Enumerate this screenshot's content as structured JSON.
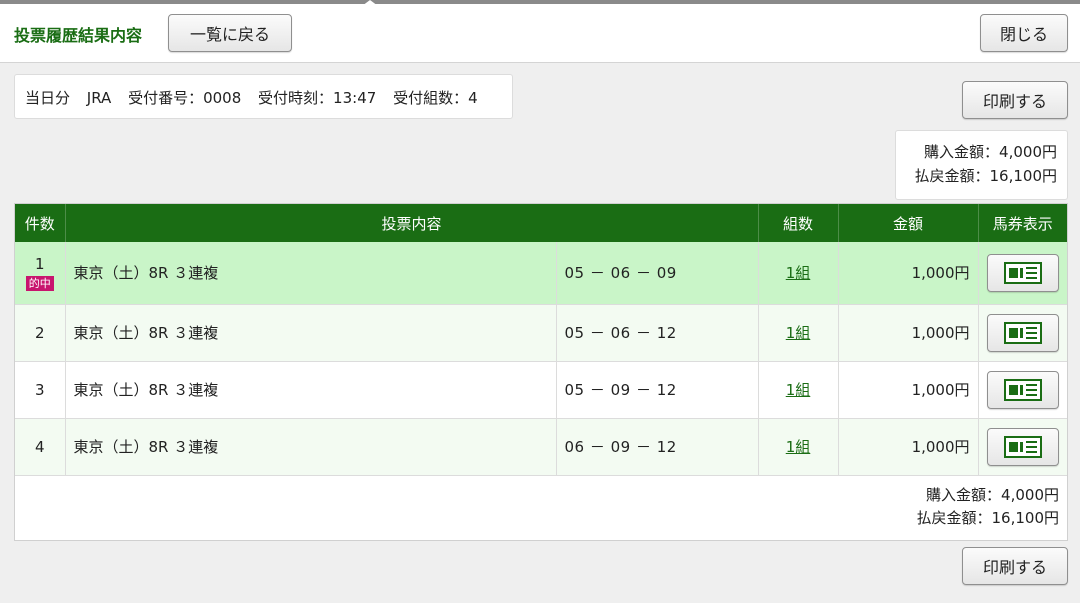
{
  "header": {
    "title": "投票履歴結果内容",
    "back_label": "一覧に戻る",
    "close_label": "閉じる"
  },
  "info": {
    "day": "当日分",
    "org": "JRA",
    "receipt_no": "受付番号：0008",
    "receipt_time": "受付時刻：13:47",
    "combo_count": "受付組数：4"
  },
  "print_label": "印刷する",
  "summary": {
    "purchase": "購入金額：4,000円",
    "refund": "払戻金額：16,100円"
  },
  "table": {
    "headers": {
      "num": "件数",
      "content": "投票内容",
      "kumi": "組数",
      "amount": "金額",
      "ticket": "馬券表示"
    },
    "rows": [
      {
        "num": "1",
        "badge": "的中",
        "race": "東京（土）8R ３連複",
        "combo": "05 － 06 － 09",
        "kumi": "1組",
        "amount": "1,000円"
      },
      {
        "num": "2",
        "badge": "",
        "race": "東京（土）8R ３連複",
        "combo": "05 － 06 － 12",
        "kumi": "1組",
        "amount": "1,000円"
      },
      {
        "num": "3",
        "badge": "",
        "race": "東京（土）8R ３連複",
        "combo": "05 － 09 － 12",
        "kumi": "1組",
        "amount": "1,000円"
      },
      {
        "num": "4",
        "badge": "",
        "race": "東京（土）8R ３連複",
        "combo": "06 － 09 － 12",
        "kumi": "1組",
        "amount": "1,000円"
      }
    ]
  },
  "colors": {
    "brand_green": "#1a6d14",
    "hit_row": "#c9f5c8",
    "hit_badge": "#c8156e"
  },
  "icons": {
    "ticket": "ticket-view-icon"
  }
}
